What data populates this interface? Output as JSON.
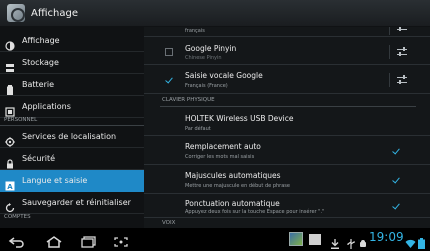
{
  "app": {
    "title": "Affichage"
  },
  "left": {
    "items": [
      {
        "label": "Affichage",
        "icon": "brightness-icon"
      },
      {
        "label": "Stockage",
        "icon": "storage-icon"
      },
      {
        "label": "Batterie",
        "icon": "battery-icon"
      },
      {
        "label": "Applications",
        "icon": "applications-icon"
      }
    ],
    "section_personnel": "PERSONNEL",
    "items2": [
      {
        "label": "Services de localisation",
        "icon": "location-icon"
      },
      {
        "label": "Sécurité",
        "icon": "lock-icon"
      },
      {
        "label": "Langue et saisie",
        "icon": "language-icon",
        "selected": true
      },
      {
        "label": "Sauvegarder et réinitialiser",
        "icon": "backup-icon"
      }
    ],
    "section_comptes": "COMPTES"
  },
  "right": {
    "top_partial_sub": "français",
    "google_pinyin": {
      "title": "Google Pinyin",
      "subtitle": "Chinese Pinyin",
      "checked": false
    },
    "saisie_vocale": {
      "title": "Saisie vocale Google",
      "subtitle": "Français (France)",
      "checked": true
    },
    "section_clavier": "CLAVIER PHYSIQUE",
    "holtek": {
      "title": "HOLTEK Wireless USB Device",
      "subtitle": "Par défaut"
    },
    "remplacement": {
      "title": "Remplacement auto",
      "subtitle": "Corriger les mots mal saisis",
      "checked": true
    },
    "majuscules": {
      "title": "Majuscules automatiques",
      "subtitle": "Mettre une majuscule en début de phrase",
      "checked": true
    },
    "ponctuation": {
      "title": "Ponctuation automatique",
      "subtitle": "Appuyez deux fois sur la touche Espace pour insérer \".\"",
      "checked": true
    },
    "section_voix": "VOIX"
  },
  "statusbar": {
    "time": "19:09"
  },
  "colors": {
    "accent": "#33b5e5",
    "selected": "#1f89c7"
  }
}
